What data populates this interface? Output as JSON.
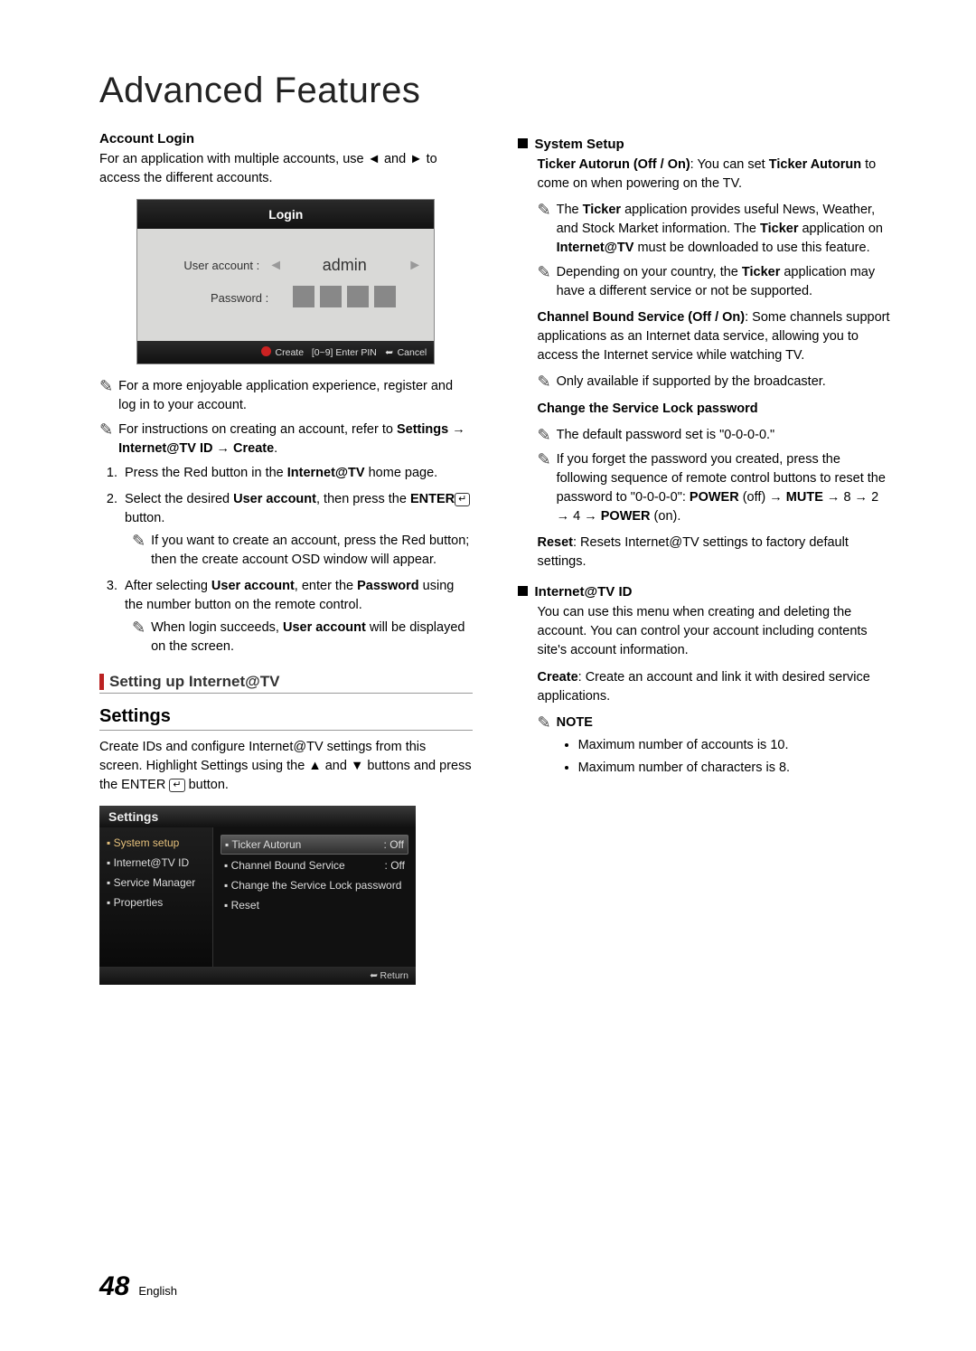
{
  "title": "Advanced Features",
  "left": {
    "account_login_head": "Account Login",
    "account_login_intro_a": "For an application with multiple accounts, use ",
    "account_login_intro_b": " and ",
    "account_login_intro_c": " to access the different accounts.",
    "arrow_left": "◄",
    "arrow_right": "►",
    "login_panel": {
      "title": "Login",
      "user_label": "User account :",
      "user_value": "admin",
      "pw_label": "Password :",
      "footer_create": "Create",
      "footer_pin": "[0~9] Enter PIN",
      "footer_cancel": "Cancel"
    },
    "tip1": "For a more enjoyable application experience, register and log in to your account.",
    "tip2_a": "For instructions on creating an account, refer to ",
    "tip2_b": "Settings → Internet@TV ID → Create",
    "tip2_c": ".",
    "step1_a": "Press the Red button in the ",
    "step1_b": "Internet@TV",
    "step1_c": " home page.",
    "step2_a": "Select the desired ",
    "step2_b": "User account",
    "step2_c": ", then press the ",
    "step2_d": "ENTER",
    "step2_e": " button.",
    "step2_tip": "If you want to create an account, press the Red button; then the create account OSD window will appear.",
    "step3_a": "After selecting ",
    "step3_b": "User account",
    "step3_c": ", enter the ",
    "step3_d": "Password",
    "step3_e": " using the number button on the remote control.",
    "step3_tip_a": "When login succeeds, ",
    "step3_tip_b": "User account",
    "step3_tip_c": " will be displayed on the screen.",
    "section_title": "Setting up Internet@TV",
    "settings_head": "Settings",
    "settings_intro_a": "Create IDs and configure Internet@TV settings from this screen. Highlight Settings using the ",
    "settings_intro_b": " and ",
    "settings_intro_c": " buttons and press the ENTER ",
    "settings_intro_d": " button.",
    "arrow_up": "▲",
    "arrow_down": "▼",
    "settings_panel": {
      "title": "Settings",
      "side": [
        "System setup",
        "Internet@TV ID",
        "Service Manager",
        "Properties"
      ],
      "right": [
        {
          "label": "Ticker Autorun",
          "value": ": Off",
          "active": true
        },
        {
          "label": "Channel Bound Service",
          "value": ": Off",
          "active": false
        },
        {
          "label": "Change the Service Lock password",
          "value": "",
          "active": false
        },
        {
          "label": "Reset",
          "value": "",
          "active": false
        }
      ],
      "return": "Return"
    }
  },
  "right": {
    "system_setup_head": "System Setup",
    "ticker_a": "Ticker Autorun (Off / On)",
    "ticker_b": ": You can set ",
    "ticker_c": "Ticker Autorun",
    "ticker_d": " to come on when powering on the TV.",
    "ticker_tip1_a": "The ",
    "ticker_tip1_b": "Ticker",
    "ticker_tip1_c": " application provides useful News, Weather, and Stock Market information. The ",
    "ticker_tip1_d": "Ticker",
    "ticker_tip1_e": " application on ",
    "ticker_tip1_f": "Internet@TV",
    "ticker_tip1_g": " must be downloaded to use this feature.",
    "ticker_tip2_a": "Depending on your country, the ",
    "ticker_tip2_b": "Ticker",
    "ticker_tip2_c": " application may have a different service or not be supported.",
    "cbs_a": "Channel Bound Service (Off / On)",
    "cbs_b": ": Some channels support applications as an Internet data service, allowing you to access the Internet service while watching TV.",
    "cbs_tip": "Only available if supported by the broadcaster.",
    "chg_head": "Change the Service Lock password",
    "chg_tip1": "The default password set is \"0-0-0-0.\"",
    "chg_tip2_a": "If you forget the password you created, press the following sequence of remote control buttons to reset the password to \"0-0-0-0\": ",
    "chg_tip2_b": "POWER",
    "chg_tip2_c": " (off) → ",
    "chg_tip2_d": "MUTE",
    "chg_tip2_e": " → 8 → 2 → 4 → ",
    "chg_tip2_f": "POWER",
    "chg_tip2_g": " (on).",
    "reset_a": "Reset",
    "reset_b": ": Resets Internet@TV settings to factory default settings.",
    "itv_head": "Internet@TV ID",
    "itv_body": "You can use this menu when creating and deleting the account. You can control your account including contents site's account information.",
    "create_a": "Create",
    "create_b": ": Create an account and link it with desired service applications.",
    "note_head": "NOTE",
    "note1": "Maximum number of accounts is 10.",
    "note2": "Maximum number of characters is 8."
  },
  "footer": {
    "page": "48",
    "lang": "English"
  }
}
